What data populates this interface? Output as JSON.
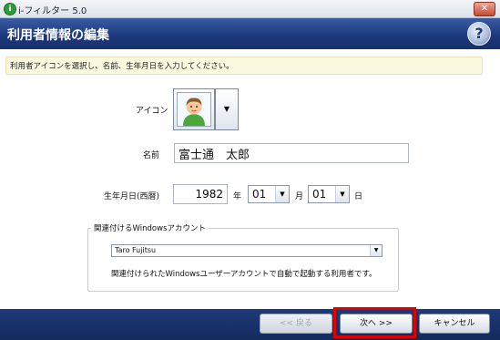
{
  "window": {
    "title": "i-フィルター 5.0",
    "app_icon_glyph": "i",
    "close_glyph": "✕"
  },
  "header": {
    "title": "利用者情報の編集",
    "help_glyph": "?"
  },
  "instruction": "利用者アイコンを選択し、名前、生年月日を入力してください。",
  "form": {
    "icon_label": "アイコン",
    "name_label": "名前",
    "name_value": "富士通　太郎",
    "birth_label": "生年月日(西暦)",
    "year_value": "1982",
    "year_unit": "年",
    "month_value": "01",
    "month_unit": "月",
    "day_value": "01",
    "day_unit": "日",
    "dropdown_arrow": "▼"
  },
  "account": {
    "legend": "関連付けるWindowsアカウント",
    "selected": "Taro Fujitsu",
    "description": "関連付けられたWindowsユーザーアカウントで自動で起動する利用者です。"
  },
  "footer": {
    "back_label": "<< 戻る",
    "next_label": "次へ >>",
    "cancel_label": "キャンセル"
  },
  "colors": {
    "header": "#1d3a7e",
    "highlight": "#e00000",
    "instruction_bg": "#fbf8e0"
  },
  "icons": {
    "avatar": "user-avatar-icon",
    "help": "help-icon",
    "close": "close-icon"
  }
}
